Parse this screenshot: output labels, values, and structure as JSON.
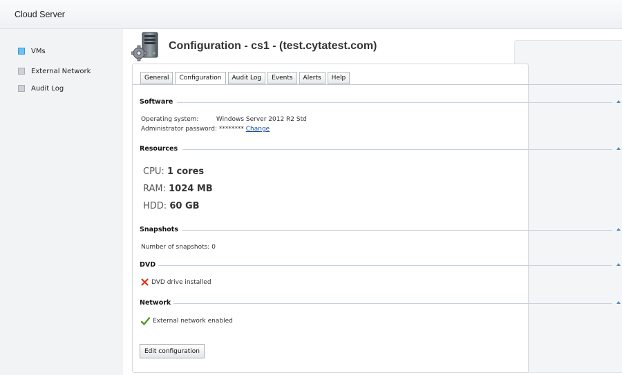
{
  "app": {
    "title": "Cloud Server"
  },
  "sidebar": {
    "items": [
      {
        "label": "VMs",
        "active": true
      },
      {
        "label": "External Network",
        "active": false
      },
      {
        "label": "Audit Log",
        "active": false
      }
    ]
  },
  "header": {
    "title": "Configuration - cs1 - (test.cytatest.com)",
    "icon": "server-gear-icon"
  },
  "tabs": [
    {
      "label": "General"
    },
    {
      "label": "Configuration",
      "active": true
    },
    {
      "label": "Audit Log"
    },
    {
      "label": "Events"
    },
    {
      "label": "Alerts"
    },
    {
      "label": "Help"
    }
  ],
  "software": {
    "title": "Software",
    "os_label": "Operating system:",
    "os_value": "Windows Server 2012 R2 Std",
    "password_label": "Administrator password:",
    "password_value": "********",
    "password_change": "Change"
  },
  "resources": {
    "title": "Resources",
    "cpu_label": "CPU:",
    "cpu_value": "1 cores",
    "ram_label": "RAM:",
    "ram_value": "1024 MB",
    "hdd_label": "HDD:",
    "hdd_value": "60 GB"
  },
  "snapshots": {
    "title": "Snapshots",
    "count_label": "Number of snapshots:",
    "count_value": "0"
  },
  "dvd": {
    "title": "DVD",
    "status": "DVD drive installed",
    "status_icon": "red-x-icon"
  },
  "network": {
    "title": "Network",
    "status": "External network enabled",
    "status_icon": "green-check-icon"
  },
  "actions": {
    "edit_label": "Edit configuration"
  },
  "colors": {
    "accent": "#3a9bd8",
    "link": "#1a4fa0",
    "error": "#e0321f",
    "success": "#4a9c1e"
  }
}
